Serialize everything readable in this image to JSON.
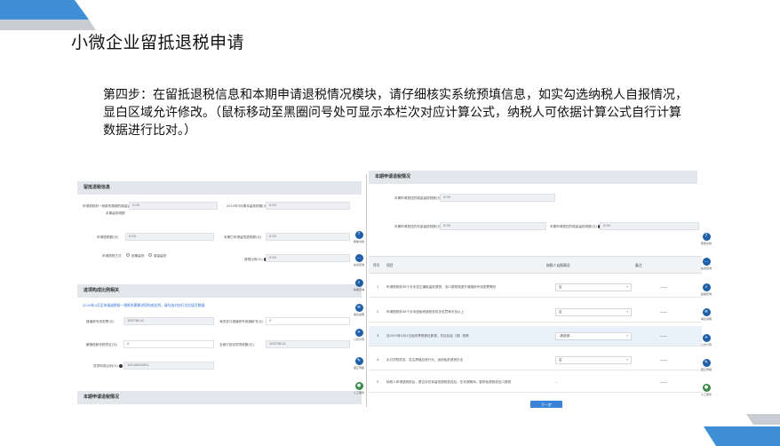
{
  "slide": {
    "title": "小微企业留抵退税申请",
    "instruction": "第四步：在留抵退税信息和本期申请退税情况模块，请仔细核实系统预填信息，如实勾选纳税人自报情况，显白区域允许修改。（鼠标移动至黑圈问号处可显示本栏次对应计算公式，纳税人可依据计算公式自行计算数据进行比对。）",
    "colors": {
      "deco_blue": "#3f8fd6",
      "deco_gray": "#c9cdd3",
      "tool_blue": "#1f5fa8",
      "button_blue": "#3a83d6"
    }
  },
  "left_panel": {
    "section1_title": "留抵退税信息",
    "section1": {
      "row1_label": "申请退税前一税款所属期的增量留抵税额(元)",
      "row1_value": "0.00",
      "row1_sublabel": "本期留抵税额",
      "row1_right_label": "2019年3月期末留抵税额(元)",
      "row1_right_value": "0.00",
      "row2_label": "申请退税额(元)",
      "row2_value": "0.00",
      "row2_right_label": "本期已申请留抵退税额(元)",
      "row2_right_value": "0.00",
      "row3_label": "申请退税方式",
      "radio1": "按期留抵",
      "radio2": "增量留抵",
      "row3_right_label": "退税比例(%)",
      "row3_right_value": "0.00"
    },
    "section2_title": "进项构成比例相关",
    "section2_note": "2019年4月至申请退税前一税款所属期进项构成比例，请勾选对应行次后填写数据",
    "section2": {
      "row1_label": "增值税专用发票(元)",
      "row1_value": "150736.41",
      "row1_right_label": "海关进口增值税专用缴款书(元)",
      "row1_right_value": "0",
      "row2_label": "解缴税款完税凭证(元)",
      "row2_value": "0",
      "row2_right_label": "全部已抵扣进项税额(元)",
      "row2_right_value": "150736.41",
      "row3_label": "进项构成比例(%)",
      "row3_value": "100.000000%"
    },
    "section3_title": "本期申请退税情况"
  },
  "right_panel": {
    "section_title": "本期申请退税情况",
    "row1_label": "本期申请退还的增量留抵税额(元)",
    "row1_value": "0.00",
    "row2_label": "本期申请退还的存量留抵税额(元)",
    "row2_value": "0.00",
    "row2_right_label": "本期申请退还的增量留抵税额(元)",
    "row2_right_value": "0.00",
    "table_headers": {
      "index": "序号",
      "item": "项目",
      "self_report": "纳税人自报情况",
      "remark": "备注"
    },
    "rows": [
      {
        "index": "1",
        "item": "申请退税前36个月未发生骗取留抵退税、出口退税或虚开增值税专用发票情形",
        "value": "否",
        "remark": "——"
      },
      {
        "index": "2",
        "item": "申请退税前36个月未因偷税被税务机关处罚两次及以上",
        "value": "否",
        "remark": "——"
      },
      {
        "index": "3",
        "item": "自2019年4月1日起未享受即征即退、先征后返（退）政策",
        "value": "-请选择-",
        "remark": "——"
      },
      {
        "index": "4",
        "item": "出口货物劳务、发生跨境应税行为，适用免抵退税办法",
        "value": "否",
        "remark": "——"
      },
      {
        "index": "5",
        "item": "纳税人申请退税前后，是否存在将留抵退税退还后，在未按期间，暂停免退税或出口退税",
        "value": "--",
        "remark": "——"
      }
    ],
    "next_button": "下一步"
  },
  "side_tools": [
    {
      "icon": "help-icon",
      "label": "帮助文档"
    },
    {
      "icon": "chat-icon",
      "label": "在线咨询"
    },
    {
      "icon": "search-icon",
      "label": "政策查询"
    },
    {
      "icon": "form-icon",
      "label": "填表说明"
    },
    {
      "icon": "calc-icon",
      "label": "公式计算"
    },
    {
      "icon": "edit-icon",
      "label": "更正申报"
    },
    {
      "icon": "person-icon",
      "label": "人工服务"
    }
  ]
}
